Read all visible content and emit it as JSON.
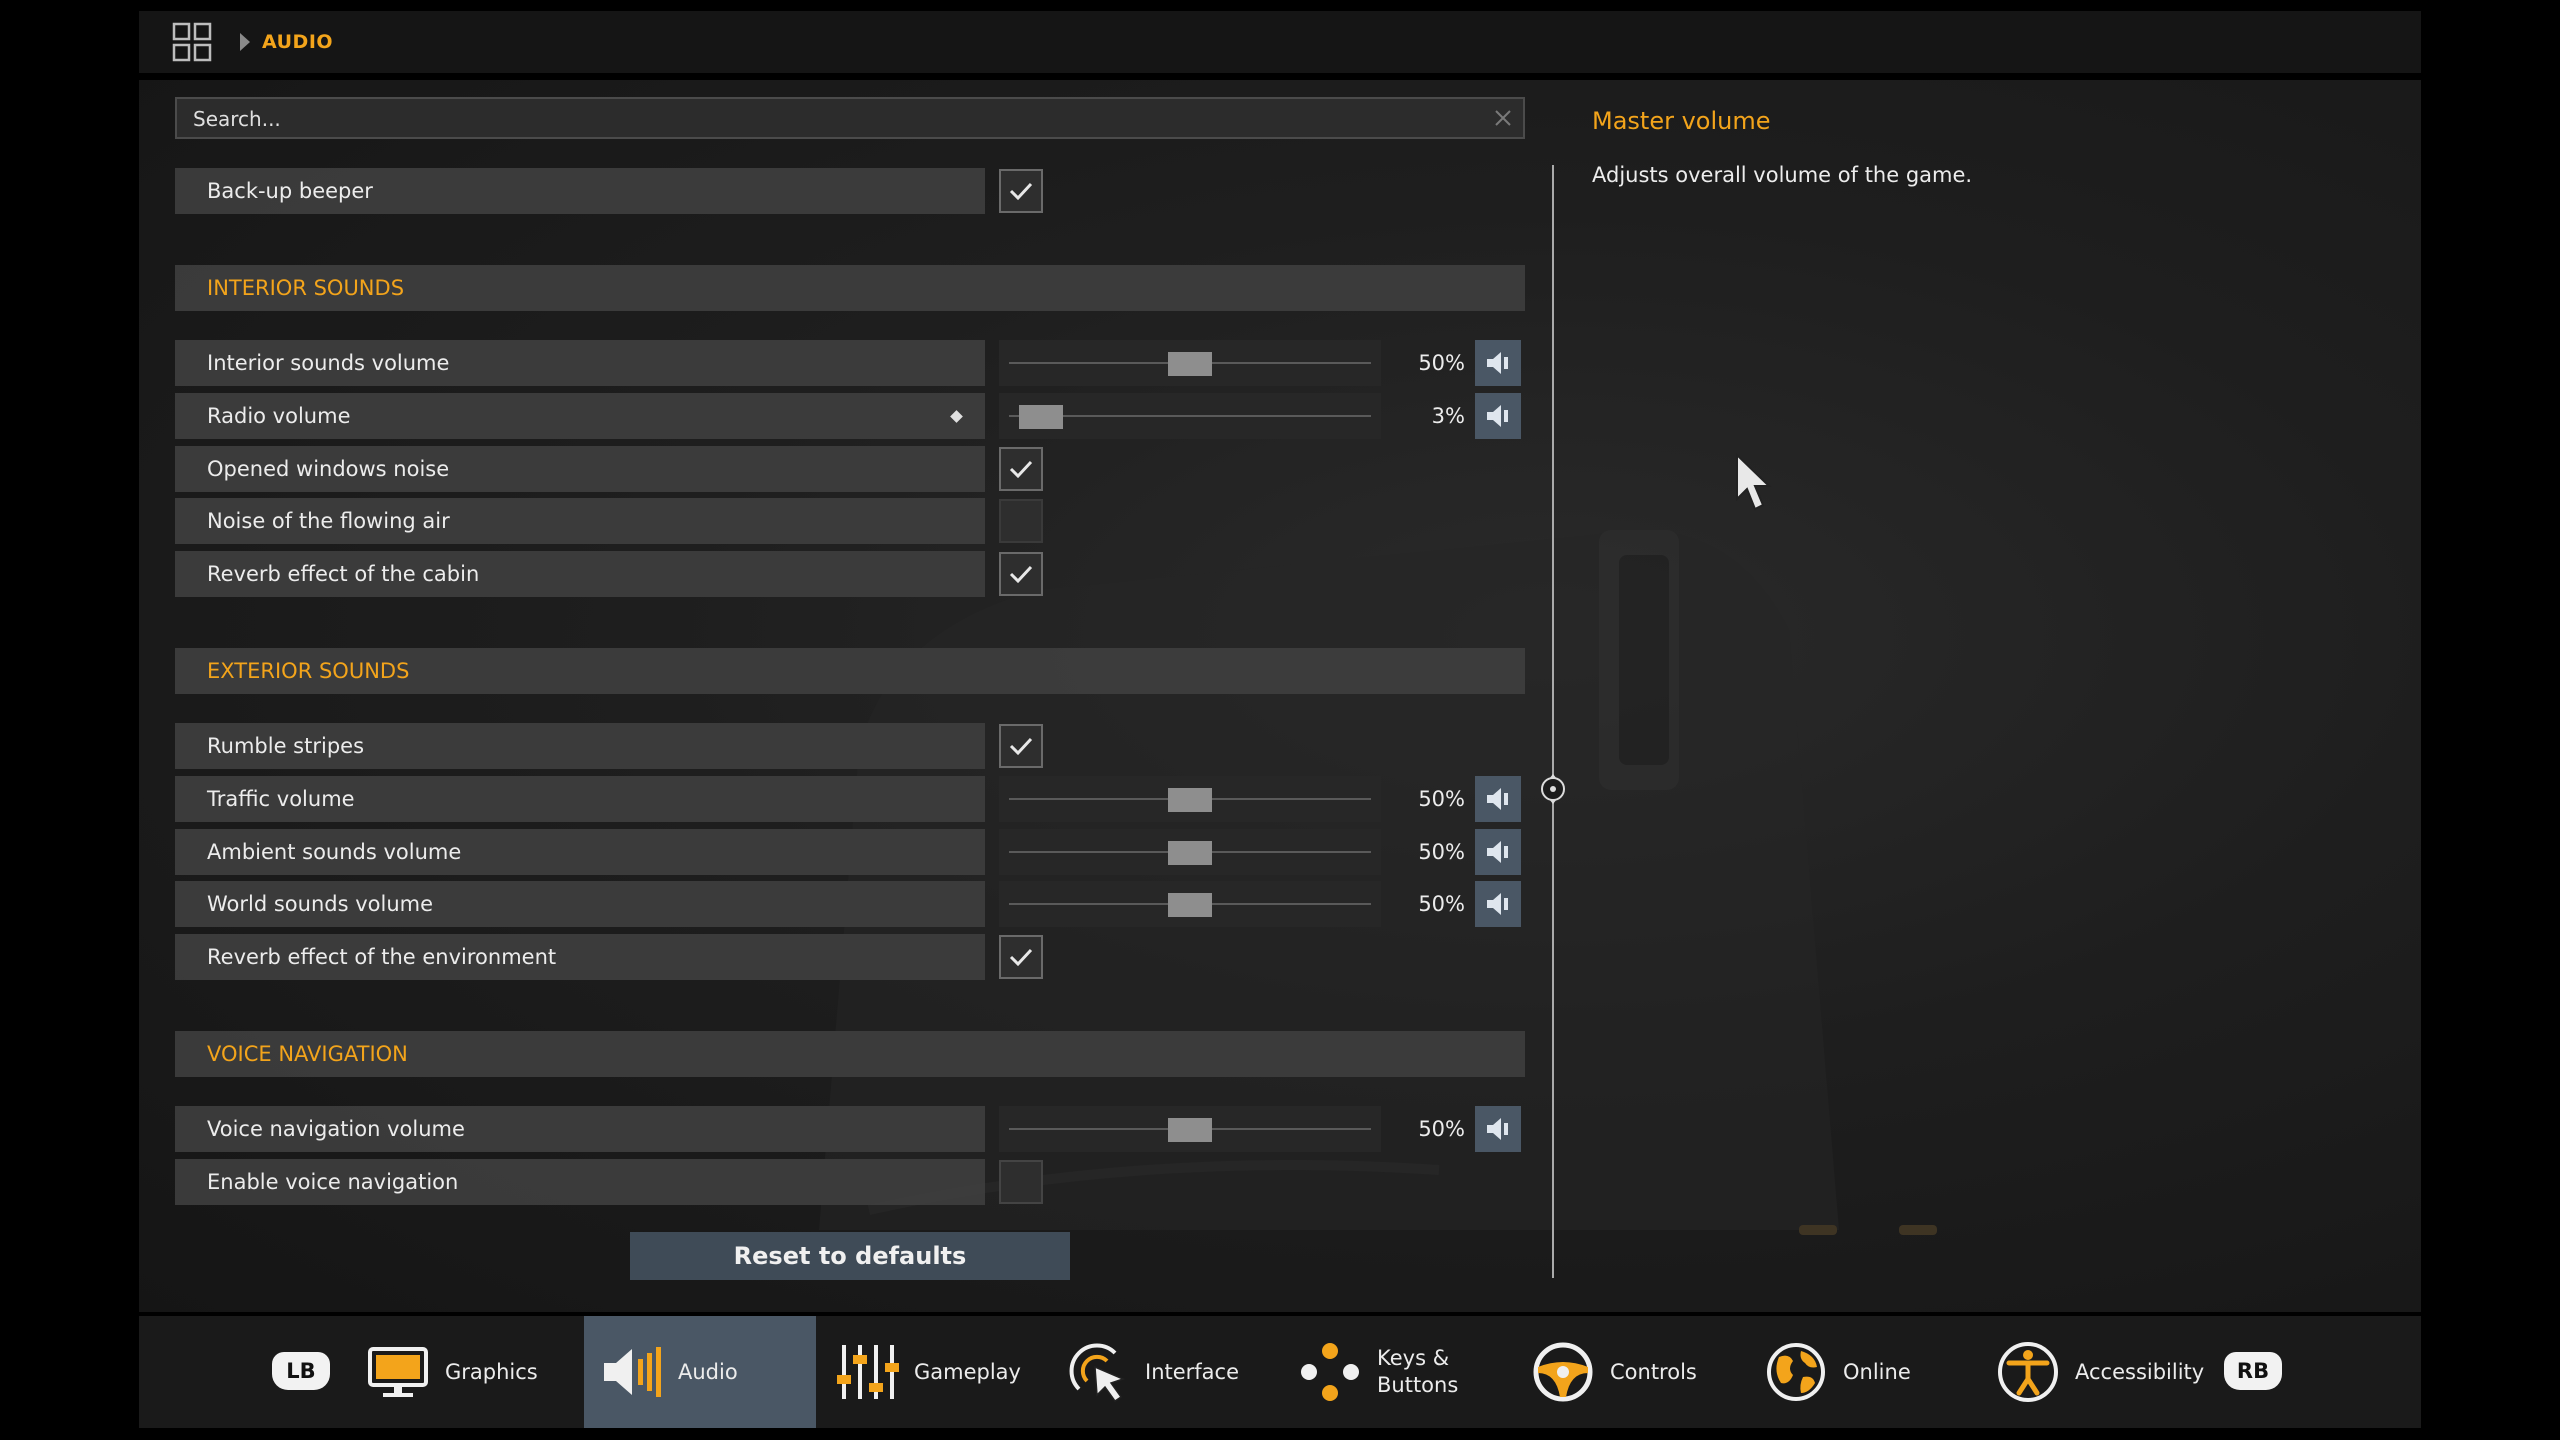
{
  "breadcrumb": {
    "current": "AUDIO"
  },
  "search": {
    "placeholder": "Search..."
  },
  "rows_top": {
    "backup_beeper": "Back-up beeper"
  },
  "sections": {
    "interior": "INTERIOR SOUNDS",
    "exterior": "EXTERIOR SOUNDS",
    "voice": "VOICE NAVIGATION"
  },
  "interior": {
    "interior_volume": {
      "label": "Interior sounds volume",
      "value": "50%",
      "level": 0.5
    },
    "radio_volume": {
      "label": "Radio volume",
      "value": "3%",
      "level": 0.03
    },
    "opened_windows": {
      "label": "Opened windows noise",
      "checked": true
    },
    "flowing_air": {
      "label": "Noise of the flowing air",
      "checked": false
    },
    "reverb_cabin": {
      "label": "Reverb effect of the cabin",
      "checked": true
    }
  },
  "exterior": {
    "rumble": {
      "label": "Rumble stripes",
      "checked": true
    },
    "traffic": {
      "label": "Traffic volume",
      "value": "50%",
      "level": 0.5
    },
    "ambient": {
      "label": "Ambient sounds volume",
      "value": "50%",
      "level": 0.5
    },
    "world": {
      "label": "World sounds volume",
      "value": "50%",
      "level": 0.5
    },
    "reverb_env": {
      "label": "Reverb effect of the environment",
      "checked": true
    }
  },
  "voice": {
    "volume": {
      "label": "Voice navigation volume",
      "value": "50%",
      "level": 0.5
    },
    "enable": {
      "label": "Enable voice navigation",
      "checked": false
    }
  },
  "description": {
    "title": "Master volume",
    "text": "Adjusts overall volume of the game."
  },
  "reset_label": "Reset to defaults",
  "nav": {
    "lb": "LB",
    "rb": "RB",
    "tabs": [
      {
        "label": "Graphics"
      },
      {
        "label": "Audio"
      },
      {
        "label": "Gameplay"
      },
      {
        "label": "Interface"
      },
      {
        "label": "Keys &\nButtons"
      },
      {
        "label": "Controls"
      },
      {
        "label": "Online"
      },
      {
        "label": "Accessibility"
      }
    ]
  },
  "colors": {
    "accent": "#f3a41b",
    "active_tab": "#4a5765"
  }
}
